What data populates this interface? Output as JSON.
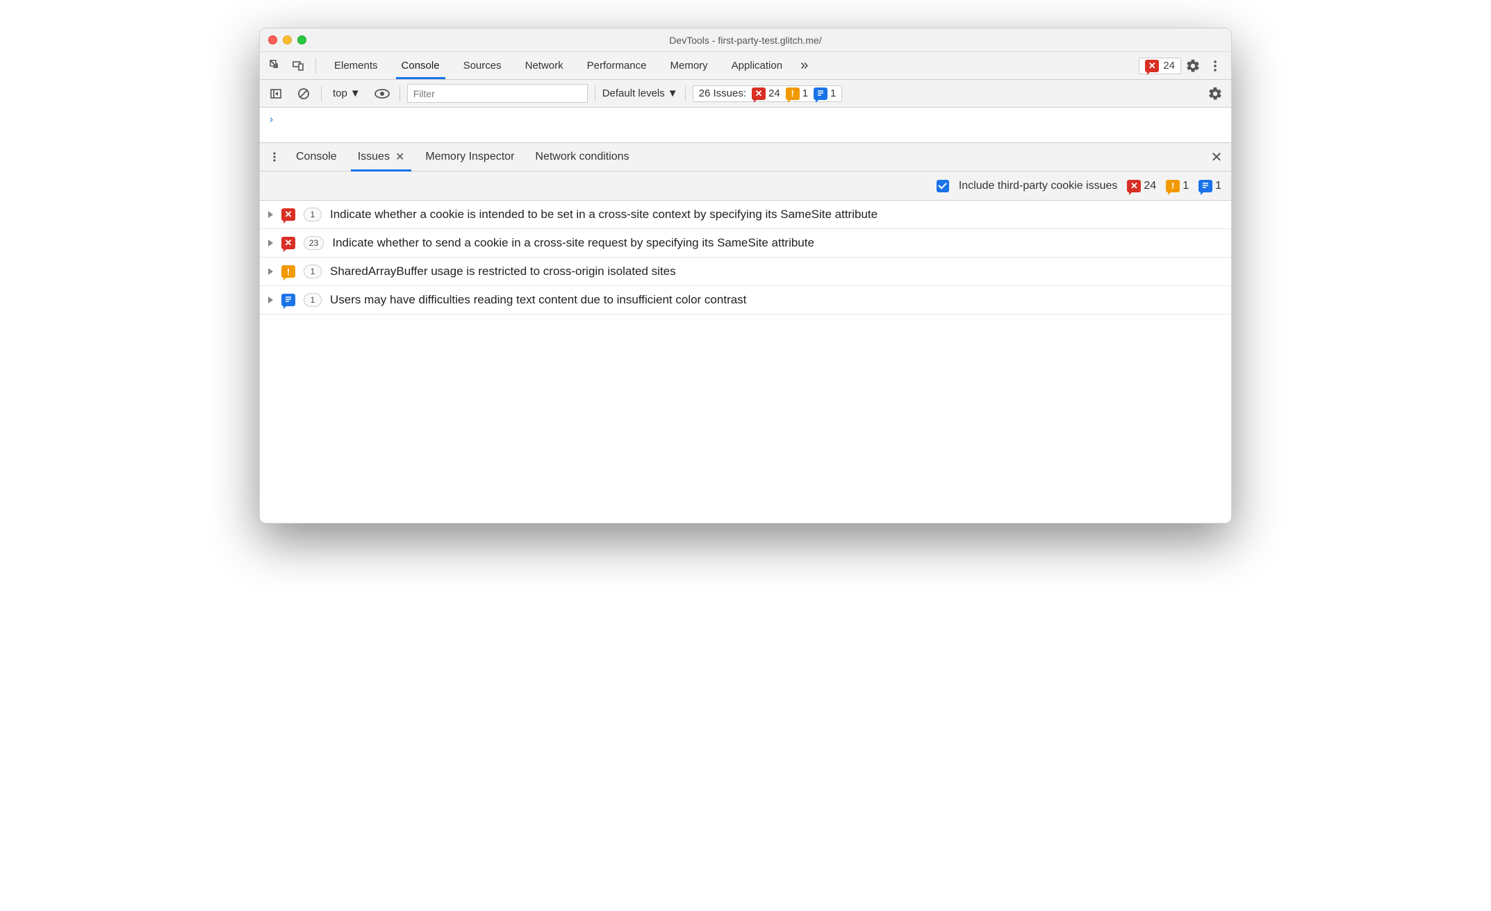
{
  "window": {
    "title": "DevTools - first-party-test.glitch.me/"
  },
  "top_tabs": {
    "items": [
      "Elements",
      "Console",
      "Sources",
      "Network",
      "Performance",
      "Memory",
      "Application"
    ],
    "active_index": 1,
    "overflow_glyph": "»",
    "error_count": "24"
  },
  "console_toolbar": {
    "context": "top",
    "filter_placeholder": "Filter",
    "levels_label": "Default levels",
    "issues_label": "26 Issues:",
    "counts": {
      "errors": "24",
      "warnings": "1",
      "info": "1"
    }
  },
  "console": {
    "prompt": "›"
  },
  "drawer_tabs": {
    "items": [
      "Console",
      "Issues",
      "Memory Inspector",
      "Network conditions"
    ],
    "active_index": 1
  },
  "issues_bar": {
    "checkbox_label": "Include third-party cookie issues",
    "checkbox_checked": true,
    "counts": {
      "errors": "24",
      "warnings": "1",
      "info": "1"
    }
  },
  "issues": [
    {
      "severity": "err",
      "count": "1",
      "title": "Indicate whether a cookie is intended to be set in a cross-site context by specifying its SameSite attribute"
    },
    {
      "severity": "err",
      "count": "23",
      "title": "Indicate whether to send a cookie in a cross-site request by specifying its SameSite attribute"
    },
    {
      "severity": "warn",
      "count": "1",
      "title": "SharedArrayBuffer usage is restricted to cross-origin isolated sites"
    },
    {
      "severity": "info",
      "count": "1",
      "title": "Users may have difficulties reading text content due to insufficient color contrast"
    }
  ]
}
